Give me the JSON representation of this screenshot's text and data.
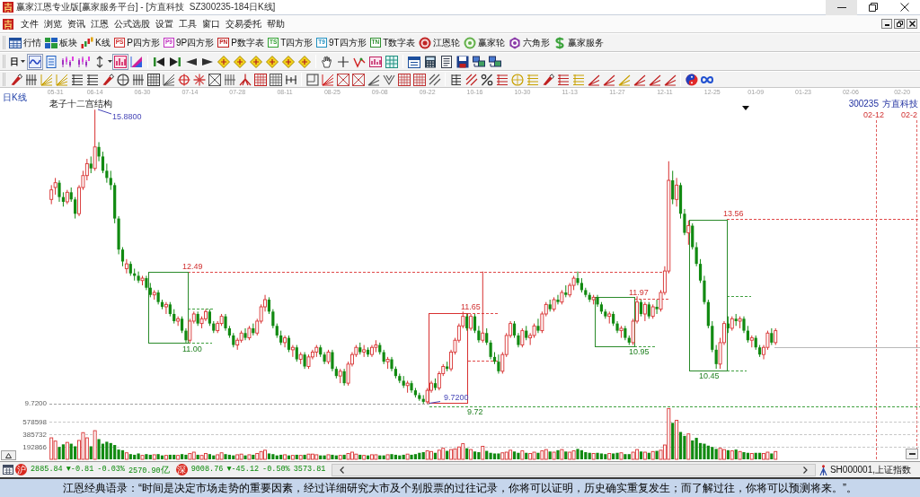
{
  "window": {
    "title": "赢家江恩专业版[赢家服务平台] - [方直科技  SZ300235-184日K线]",
    "controls": [
      {
        "kind": "minimize",
        "hovered": true
      },
      {
        "kind": "maximize",
        "hovered": false
      },
      {
        "kind": "close",
        "hovered": false
      }
    ]
  },
  "menu": [
    "文件",
    "浏览",
    "资讯",
    "江恩",
    "公式选股",
    "设置",
    "工具",
    "窗口",
    "交易委托",
    "帮助"
  ],
  "main_toolbar": [
    {
      "label": "行情"
    },
    {
      "label": "板块"
    },
    {
      "label": "K线"
    },
    {
      "label": "P四方形",
      "badge": "PS",
      "color": "#d03030"
    },
    {
      "label": "9P四方形",
      "badge": "P9",
      "color": "#c030c0"
    },
    {
      "label": "P数字表",
      "badge": "PN",
      "color": "#c02020"
    },
    {
      "label": "T四方形",
      "badge": "TS",
      "color": "#30a030"
    },
    {
      "label": "9T四方形",
      "badge": "T9",
      "color": "#2090c0"
    },
    {
      "label": "T数字表",
      "badge": "TN",
      "color": "#309030"
    },
    {
      "label": "江恩轮"
    },
    {
      "label": "赢家轮"
    },
    {
      "label": "六角形"
    },
    {
      "label": "赢家服务"
    }
  ],
  "view_toolbar": {
    "period": "日",
    "buttons": [
      {
        "selected": true
      },
      {
        "selected": false
      },
      {
        "selected": false
      },
      {
        "selected": false
      },
      {
        "selected": false
      },
      {
        "selected": true
      },
      {
        "selected": false
      }
    ]
  },
  "chart": {
    "period": "日K线",
    "indicator": "老子十二宫结构",
    "stock_code": "300235",
    "stock_name": "方直科技",
    "date_markers": [
      "02-12",
      "02-2"
    ],
    "axis_price": "9.7200",
    "price_labels": [
      {
        "text": "15.8800",
        "kind": "extreme"
      },
      {
        "text": "12.49",
        "kind": "high"
      },
      {
        "text": "11.00",
        "kind": "low"
      },
      {
        "text": "11.65",
        "kind": "high"
      },
      {
        "text": "9.7200",
        "kind": "extreme"
      },
      {
        "text": "9.72",
        "kind": "low"
      },
      {
        "text": "11.97",
        "kind": "high"
      },
      {
        "text": "10.95",
        "kind": "low"
      },
      {
        "text": "13.56",
        "kind": "high"
      },
      {
        "text": "10.45",
        "kind": "low"
      }
    ],
    "chart_data": {
      "type": "candlestick",
      "categories": [
        null,
        "05-31",
        null,
        null,
        null,
        null,
        null,
        null,
        null,
        null,
        null,
        "06-14",
        null,
        null,
        null,
        null,
        null,
        null,
        null,
        null,
        null,
        null,
        null,
        "06-30",
        null,
        null,
        null,
        null,
        null,
        null,
        null,
        null,
        null,
        null,
        null,
        "07-14",
        null,
        null,
        null,
        null,
        null,
        null,
        null,
        null,
        null,
        null,
        null,
        "07-28",
        null,
        null,
        null,
        null,
        null,
        null,
        null,
        null,
        null,
        null,
        null,
        "08-11",
        null,
        null,
        null,
        null,
        null,
        null,
        null,
        null,
        null,
        null,
        null,
        "08-25",
        null,
        null,
        null,
        null,
        null,
        null,
        null,
        null,
        null,
        null,
        null,
        "09-08",
        null,
        null,
        null,
        null,
        null,
        null,
        null,
        null,
        null,
        null,
        null,
        "09-22",
        null,
        null,
        null,
        null,
        null,
        null,
        null,
        null,
        null,
        null,
        null,
        "10-16",
        null,
        null,
        null,
        null,
        null,
        null,
        null,
        null,
        null,
        null,
        null,
        "10-30",
        null,
        null,
        null,
        null,
        null,
        null,
        null,
        null,
        null,
        null,
        null,
        "11-13",
        null,
        null,
        null,
        null,
        null,
        null,
        null,
        null,
        null,
        null,
        null,
        "11-27",
        null,
        null,
        null,
        null,
        null,
        null,
        null,
        null,
        null,
        null,
        null,
        "12-11",
        null,
        null,
        null,
        null,
        null,
        null,
        null,
        null,
        null,
        null,
        null,
        "12-25",
        null,
        null,
        null,
        null,
        null,
        null,
        null,
        null,
        null,
        null,
        "01-09",
        null,
        null,
        null,
        null,
        null,
        null,
        null,
        null,
        null,
        null,
        null,
        "01-23",
        null,
        null,
        null,
        null,
        null,
        null,
        null,
        null,
        null,
        null,
        null,
        "02-06",
        null,
        null,
        null,
        null,
        null,
        null,
        null,
        null,
        null,
        null,
        null,
        null,
        "02-20",
        null,
        null,
        null,
        null
      ],
      "ohlc": [
        [
          14.0,
          14.3,
          13.9,
          14.2
        ],
        [
          14.25,
          14.45,
          14.1,
          14.35
        ],
        [
          14.35,
          14.4,
          13.95,
          14.05
        ],
        [
          14.05,
          14.15,
          13.85,
          13.95
        ],
        [
          13.95,
          14.2,
          13.9,
          14.15
        ],
        [
          14.15,
          14.25,
          13.95,
          14.0
        ],
        [
          14.0,
          14.05,
          13.6,
          13.7
        ],
        [
          13.7,
          14.3,
          13.65,
          14.25
        ],
        [
          14.25,
          14.6,
          14.2,
          14.5
        ],
        [
          14.5,
          14.85,
          14.4,
          14.75
        ],
        [
          14.75,
          14.9,
          14.55,
          14.65
        ],
        [
          14.65,
          15.88,
          14.6,
          15.1
        ],
        [
          15.1,
          15.2,
          14.8,
          14.9
        ],
        [
          14.9,
          15.0,
          14.55,
          14.6
        ],
        [
          14.6,
          14.75,
          14.35,
          14.45
        ],
        [
          14.45,
          14.6,
          14.2,
          14.3
        ],
        [
          14.3,
          14.35,
          13.5,
          13.6
        ],
        [
          13.6,
          13.65,
          12.85,
          12.95
        ],
        [
          12.95,
          13.0,
          12.6,
          12.7
        ],
        [
          12.55,
          12.75,
          12.45,
          12.65
        ],
        [
          12.65,
          12.7,
          12.4,
          12.45
        ],
        [
          12.45,
          12.55,
          12.3,
          12.4
        ],
        [
          12.4,
          12.49,
          12.25,
          12.3
        ],
        [
          12.3,
          12.4,
          12.2,
          12.35
        ],
        [
          12.35,
          12.4,
          12.1,
          12.15
        ],
        [
          12.15,
          12.25,
          11.95,
          12.0
        ],
        [
          12.0,
          12.1,
          11.9,
          12.05
        ],
        [
          12.05,
          12.1,
          11.8,
          11.85
        ],
        [
          11.85,
          11.9,
          11.7,
          11.75
        ],
        [
          11.75,
          11.85,
          11.6,
          11.8
        ],
        [
          11.8,
          11.85,
          11.55,
          11.6
        ],
        [
          11.6,
          11.7,
          11.4,
          11.45
        ],
        [
          11.45,
          11.55,
          11.35,
          11.5
        ],
        [
          11.5,
          11.55,
          11.2,
          11.25
        ],
        [
          11.25,
          11.3,
          11.0,
          11.05
        ],
        [
          11.05,
          11.5,
          11.0,
          11.45
        ],
        [
          11.45,
          11.65,
          11.4,
          11.6
        ],
        [
          11.6,
          11.65,
          11.35,
          11.4
        ],
        [
          11.4,
          11.55,
          11.3,
          11.5
        ],
        [
          11.5,
          11.7,
          11.45,
          11.65
        ],
        [
          11.65,
          11.7,
          11.35,
          11.4
        ],
        [
          11.4,
          11.45,
          11.2,
          11.25
        ],
        [
          11.25,
          11.45,
          11.2,
          11.4
        ],
        [
          11.4,
          11.6,
          11.35,
          11.55
        ],
        [
          11.55,
          11.6,
          11.25,
          11.3
        ],
        [
          11.3,
          11.35,
          11.1,
          11.15
        ],
        [
          11.15,
          11.2,
          10.9,
          10.95
        ],
        [
          10.95,
          11.1,
          10.85,
          11.05
        ],
        [
          11.05,
          11.25,
          11.0,
          11.2
        ],
        [
          11.2,
          11.3,
          11.05,
          11.1
        ],
        [
          11.1,
          11.35,
          11.05,
          11.3
        ],
        [
          11.3,
          11.4,
          11.15,
          11.2
        ],
        [
          11.2,
          11.5,
          11.15,
          11.45
        ],
        [
          11.45,
          11.8,
          11.4,
          11.75
        ],
        [
          11.75,
          12.0,
          11.65,
          11.9
        ],
        [
          11.9,
          11.95,
          11.6,
          11.65
        ],
        [
          11.65,
          11.7,
          11.3,
          11.35
        ],
        [
          11.35,
          11.4,
          11.1,
          11.15
        ],
        [
          11.15,
          11.25,
          10.95,
          11.0
        ],
        [
          11.0,
          11.15,
          10.9,
          11.1
        ],
        [
          11.1,
          11.15,
          10.8,
          10.85
        ],
        [
          10.85,
          10.95,
          10.7,
          10.9
        ],
        [
          10.9,
          10.95,
          10.6,
          10.65
        ],
        [
          10.65,
          10.8,
          10.55,
          10.75
        ],
        [
          10.75,
          10.8,
          10.45,
          10.5
        ],
        [
          10.5,
          10.75,
          10.45,
          10.7
        ],
        [
          10.7,
          10.85,
          10.65,
          10.8
        ],
        [
          10.8,
          10.95,
          10.7,
          10.9
        ],
        [
          10.9,
          10.95,
          10.7,
          10.75
        ],
        [
          10.75,
          10.8,
          10.55,
          10.6
        ],
        [
          10.6,
          10.85,
          10.55,
          10.8
        ],
        [
          10.8,
          10.85,
          10.4,
          10.45
        ],
        [
          10.45,
          10.5,
          10.25,
          10.3
        ],
        [
          10.3,
          10.45,
          10.15,
          10.4
        ],
        [
          10.4,
          10.45,
          10.1,
          10.15
        ],
        [
          10.15,
          10.6,
          10.1,
          10.55
        ],
        [
          10.55,
          10.8,
          10.5,
          10.75
        ],
        [
          10.75,
          10.95,
          10.7,
          10.9
        ],
        [
          10.9,
          11.0,
          10.75,
          10.8
        ],
        [
          10.8,
          10.95,
          10.7,
          10.85
        ],
        [
          10.85,
          10.9,
          10.7,
          10.75
        ],
        [
          10.75,
          10.95,
          10.7,
          10.9
        ],
        [
          10.9,
          11.05,
          10.8,
          10.95
        ],
        [
          10.95,
          11.0,
          10.75,
          10.8
        ],
        [
          10.8,
          10.85,
          10.55,
          10.6
        ],
        [
          10.6,
          10.7,
          10.45,
          10.65
        ],
        [
          10.65,
          10.7,
          10.4,
          10.45
        ],
        [
          10.45,
          10.5,
          10.25,
          10.3
        ],
        [
          10.3,
          10.35,
          10.15,
          10.2
        ],
        [
          10.2,
          10.3,
          10.05,
          10.1
        ],
        [
          10.1,
          10.2,
          9.95,
          10.15
        ],
        [
          10.15,
          10.2,
          9.95,
          10.0
        ],
        [
          10.0,
          10.05,
          9.85,
          9.9
        ],
        [
          9.9,
          9.95,
          9.78,
          9.82
        ],
        [
          9.82,
          9.9,
          9.72,
          9.76
        ],
        [
          9.76,
          10.05,
          9.72,
          10.0
        ],
        [
          10.0,
          10.2,
          9.95,
          10.15
        ],
        [
          10.15,
          10.25,
          10.0,
          10.05
        ],
        [
          10.05,
          10.4,
          10.0,
          10.35
        ],
        [
          10.35,
          10.55,
          10.3,
          10.5
        ],
        [
          10.5,
          10.6,
          10.4,
          10.45
        ],
        [
          10.45,
          10.85,
          10.4,
          10.8
        ],
        [
          10.8,
          11.1,
          10.75,
          11.05
        ],
        [
          11.05,
          11.4,
          11.0,
          11.35
        ],
        [
          11.35,
          11.65,
          11.3,
          11.55
        ],
        [
          11.55,
          11.6,
          11.25,
          11.3
        ],
        [
          11.3,
          11.6,
          11.25,
          11.55
        ],
        [
          11.55,
          11.6,
          11.2,
          11.25
        ],
        [
          11.25,
          11.35,
          11.0,
          11.05
        ],
        [
          11.05,
          12.49,
          11.0,
          11.2
        ],
        [
          11.2,
          11.3,
          10.95,
          11.0
        ],
        [
          11.0,
          11.05,
          10.65,
          10.7
        ],
        [
          10.7,
          10.8,
          10.55,
          10.6
        ],
        [
          10.6,
          10.75,
          10.35,
          10.4
        ],
        [
          10.4,
          10.8,
          10.35,
          10.75
        ],
        [
          10.75,
          11.2,
          10.7,
          11.15
        ],
        [
          11.15,
          11.45,
          11.1,
          11.4
        ],
        [
          11.4,
          11.45,
          11.1,
          11.15
        ],
        [
          11.15,
          11.2,
          10.9,
          10.95
        ],
        [
          10.95,
          11.3,
          10.9,
          11.25
        ],
        [
          11.25,
          11.35,
          11.05,
          11.1
        ],
        [
          11.1,
          11.2,
          10.95,
          11.15
        ],
        [
          11.15,
          11.4,
          11.1,
          11.35
        ],
        [
          11.35,
          11.5,
          11.2,
          11.25
        ],
        [
          11.25,
          11.65,
          11.2,
          11.6
        ],
        [
          11.6,
          11.85,
          11.55,
          11.8
        ],
        [
          11.8,
          11.9,
          11.65,
          11.7
        ],
        [
          11.7,
          11.95,
          11.65,
          11.9
        ],
        [
          11.9,
          12.0,
          11.8,
          11.85
        ],
        [
          11.85,
          12.1,
          11.8,
          12.05
        ],
        [
          12.05,
          12.2,
          11.95,
          12.0
        ],
        [
          12.0,
          12.25,
          11.95,
          12.2
        ],
        [
          12.2,
          12.4,
          12.1,
          12.35
        ],
        [
          12.35,
          12.49,
          12.2,
          12.25
        ],
        [
          12.25,
          12.35,
          12.05,
          12.1
        ],
        [
          12.1,
          12.15,
          11.95,
          12.0
        ],
        [
          12.0,
          12.05,
          11.85,
          11.9
        ],
        [
          11.9,
          12.0,
          11.8,
          11.95
        ],
        [
          11.95,
          12.0,
          11.75,
          11.8
        ],
        [
          11.8,
          11.85,
          11.6,
          11.65
        ],
        [
          11.65,
          11.7,
          11.5,
          11.55
        ],
        [
          11.55,
          11.65,
          11.4,
          11.6
        ],
        [
          11.6,
          11.65,
          11.35,
          11.4
        ],
        [
          11.4,
          11.45,
          11.2,
          11.25
        ],
        [
          11.25,
          11.35,
          11.1,
          11.3
        ],
        [
          11.3,
          11.35,
          11.05,
          11.1
        ],
        [
          11.1,
          11.15,
          10.95,
          11.0
        ],
        [
          11.0,
          11.5,
          10.95,
          11.45
        ],
        [
          11.45,
          11.97,
          11.4,
          11.85
        ],
        [
          11.85,
          11.9,
          11.55,
          11.6
        ],
        [
          11.6,
          11.85,
          11.45,
          11.8
        ],
        [
          11.8,
          11.85,
          11.5,
          11.55
        ],
        [
          11.55,
          11.8,
          11.5,
          11.75
        ],
        [
          11.75,
          11.9,
          11.6,
          11.7
        ],
        [
          11.7,
          12.1,
          11.65,
          12.05
        ],
        [
          12.05,
          12.6,
          12.0,
          12.5
        ],
        [
          12.5,
          14.8,
          12.45,
          14.4
        ],
        [
          14.4,
          14.6,
          13.9,
          14.0
        ],
        [
          14.0,
          14.45,
          13.85,
          14.3
        ],
        [
          14.3,
          14.35,
          13.6,
          13.7
        ],
        [
          13.7,
          13.8,
          13.25,
          13.3
        ],
        [
          13.3,
          13.56,
          13.05,
          13.45
        ],
        [
          13.45,
          13.5,
          12.95,
          13.0
        ],
        [
          13.0,
          13.1,
          12.6,
          12.65
        ],
        [
          12.65,
          12.75,
          12.25,
          12.3
        ],
        [
          12.3,
          12.4,
          11.8,
          11.85
        ],
        [
          11.85,
          11.9,
          11.3,
          11.35
        ],
        [
          11.35,
          11.45,
          10.8,
          10.85
        ],
        [
          10.85,
          10.95,
          10.45,
          10.55
        ],
        [
          10.55,
          11.1,
          10.45,
          11.0
        ],
        [
          11.0,
          11.45,
          10.95,
          11.4
        ],
        [
          11.4,
          11.55,
          11.2,
          11.3
        ],
        [
          11.3,
          11.55,
          11.25,
          11.5
        ],
        [
          11.5,
          11.6,
          11.35,
          11.45
        ],
        [
          11.45,
          11.55,
          11.3,
          11.5
        ],
        [
          11.5,
          11.55,
          11.2,
          11.25
        ],
        [
          11.25,
          11.35,
          11.0,
          11.05
        ],
        [
          11.05,
          11.15,
          10.9,
          11.1
        ],
        [
          11.1,
          11.15,
          10.85,
          10.9
        ],
        [
          10.9,
          10.95,
          10.7,
          10.75
        ],
        [
          10.75,
          10.95,
          10.65,
          10.9
        ],
        [
          10.9,
          11.25,
          10.85,
          11.2
        ],
        [
          11.2,
          11.3,
          10.95,
          11.0
        ],
        [
          11.0,
          11.3,
          10.95,
          11.25
        ],
        null,
        null,
        null,
        null,
        null,
        null,
        null,
        null,
        null,
        null,
        null,
        null,
        null,
        null,
        null,
        null,
        null,
        null,
        null,
        null,
        null,
        null,
        null,
        null,
        null,
        null,
        null,
        null,
        null,
        null,
        null,
        null,
        null,
        null,
        null,
        null
      ]
    },
    "volume": {
      "chart_data": {
        "type": "bar",
        "grid": true,
        "categories": [
          null,
          null,
          null,
          null,
          null,
          null,
          null,
          null,
          null,
          null,
          null,
          null,
          null,
          null,
          null,
          null,
          null,
          null,
          null,
          null,
          null,
          null,
          null,
          null,
          null,
          null,
          null,
          null,
          null,
          null,
          null,
          null,
          null,
          null,
          null,
          null,
          null,
          null,
          null,
          null,
          null,
          null,
          null,
          null,
          null,
          null,
          null,
          null,
          null,
          null,
          null,
          null,
          null,
          null,
          null,
          null,
          null,
          null,
          null,
          null,
          null,
          null,
          null,
          null,
          null,
          null,
          null,
          null,
          null,
          null,
          null,
          null,
          null,
          null,
          null,
          null,
          null,
          null,
          null,
          null,
          null,
          null,
          null,
          null,
          null,
          null,
          null,
          null,
          null,
          null,
          null,
          null,
          null,
          null,
          null,
          null,
          null,
          null,
          null,
          null,
          null,
          null,
          null,
          null,
          null,
          null,
          null,
          null,
          null,
          null,
          null,
          null,
          null,
          null,
          null,
          null,
          null,
          null,
          null,
          null,
          null,
          null,
          null,
          null,
          null,
          null,
          null,
          null,
          null,
          null,
          null,
          null,
          null,
          null,
          null,
          null,
          null,
          null,
          null,
          null,
          null,
          null,
          null,
          null,
          null,
          null,
          null,
          null,
          null,
          null,
          null,
          null,
          null,
          null,
          null,
          null,
          null,
          null,
          null,
          null,
          null,
          null,
          null,
          null,
          null,
          null,
          null,
          null,
          null,
          null,
          null,
          null,
          null,
          null,
          null,
          null,
          null,
          null,
          null,
          null,
          null,
          null,
          null,
          null,
          null,
          null,
          null,
          null,
          null,
          null,
          null,
          null,
          null,
          null,
          null,
          null,
          null,
          null,
          null,
          null,
          null,
          null,
          null,
          null,
          null,
          null,
          null,
          null,
          null,
          null,
          null,
          null,
          null,
          null,
          null,
          null,
          null,
          null,
          null,
          null
        ],
        "values": [
          330000,
          280000,
          190000,
          230000,
          260000,
          240000,
          200000,
          290000,
          410000,
          330000,
          200000,
          440000,
          310000,
          240000,
          270000,
          250000,
          220000,
          150000,
          140000,
          100000,
          80000,
          70000,
          90000,
          60000,
          80000,
          70000,
          70000,
          80000,
          60000,
          60000,
          70000,
          70000,
          60000,
          80000,
          70000,
          90000,
          110000,
          70000,
          60000,
          90000,
          80000,
          60000,
          70000,
          100000,
          80000,
          70000,
          60000,
          70000,
          80000,
          60000,
          70000,
          70000,
          90000,
          120000,
          140000,
          90000,
          80000,
          60000,
          70000,
          70000,
          60000,
          60000,
          70000,
          60000,
          70000,
          80000,
          80000,
          70000,
          60000,
          60000,
          70000,
          70000,
          60000,
          60000,
          70000,
          90000,
          110000,
          80000,
          70000,
          60000,
          60000,
          70000,
          70000,
          60000,
          60000,
          70000,
          80000,
          70000,
          60000,
          70000,
          80000,
          70000,
          80000,
          100000,
          110000,
          130000,
          120000,
          100000,
          140000,
          170000,
          130000,
          150000,
          160000,
          190000,
          240000,
          170000,
          150000,
          120000,
          110000,
          200000,
          130000,
          100000,
          90000,
          90000,
          100000,
          110000,
          140000,
          120000,
          100000,
          130000,
          100000,
          90000,
          110000,
          100000,
          130000,
          150000,
          120000,
          110000,
          140000,
          150000,
          120000,
          110000,
          130000,
          160000,
          140000,
          110000,
          100000,
          90000,
          100000,
          90000,
          80000,
          90000,
          90000,
          100000,
          100000,
          80000,
          80000,
          110000,
          150000,
          120000,
          110000,
          100000,
          120000,
          130000,
          140000,
          220000,
          780000,
          560000,
          600000,
          420000,
          360000,
          390000,
          290000,
          330000,
          250000,
          240000,
          210000,
          190000,
          160000,
          170000,
          150000,
          140000,
          130000,
          150000,
          120000,
          110000,
          100000,
          90000,
          100000,
          100000,
          90000,
          110000,
          90000,
          120000,
          null,
          null,
          null,
          null,
          null,
          null,
          null,
          null,
          null,
          null,
          null,
          null,
          null,
          null,
          null,
          null,
          null,
          null,
          null,
          null,
          null,
          null,
          null,
          null,
          null,
          null,
          null,
          null,
          null,
          null,
          null,
          null,
          null,
          null,
          null,
          null
        ],
        "ylim": [
          0,
          785239
        ],
        "yticks": [
          578598,
          385732,
          192866
        ]
      }
    }
  },
  "index_bar": [
    {
      "market": "沪",
      "value": "2885.84",
      "change": "▼-0.81",
      "percent": "-0.03%",
      "turnover": "2570.90亿"
    },
    {
      "market": "深",
      "value": "9008.76",
      "change": "▼-45.12",
      "percent": "-0.50%",
      "turnover": "3573.81"
    }
  ],
  "index_selector": "SH000001,上证指数",
  "quote": "江恩经典语录：“时间是决定市场走势的重要因素，经过详细研究大市及个别股票的过往记录，你将可以证明，历史确实重复发生；而了解过往，你将可以预测将来。”。"
}
